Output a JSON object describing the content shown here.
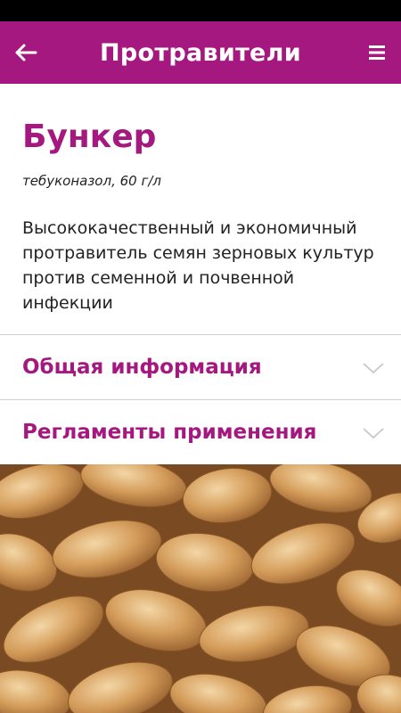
{
  "app_bar": {
    "title": "Протравители",
    "back_icon": "arrow-left-icon",
    "menu_icon": "hamburger-menu-icon",
    "color": "#a4187f"
  },
  "product": {
    "name": "Бункер",
    "active_ingredient": "тебуконазол, 60 г/л",
    "description": "Высококачественный и экономичный протравитель семян зерновых культур против семенной и почвенной инфекции"
  },
  "sections": [
    {
      "label": "Общая информация",
      "icon": "chevron-down-icon"
    },
    {
      "label": "Регламенты применения",
      "icon": "chevron-down-icon"
    }
  ],
  "image": {
    "subject": "wheat-grains-photo"
  }
}
